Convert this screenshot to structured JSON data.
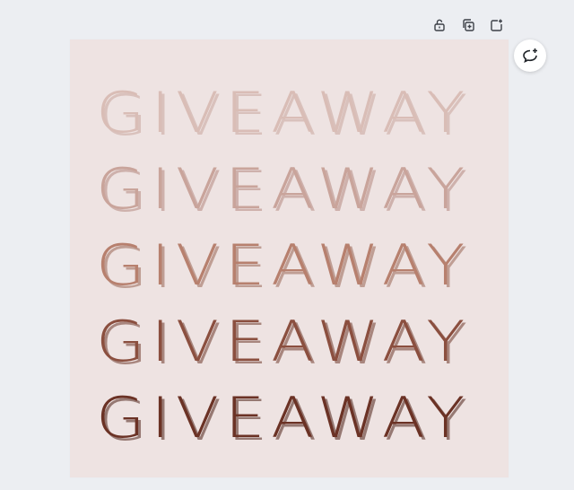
{
  "toolbar": {
    "lock_icon": "lock-open-icon",
    "duplicate_icon": "duplicate-page-icon",
    "add_page_icon": "add-page-icon"
  },
  "comment": {
    "icon": "add-comment-icon"
  },
  "canvas": {
    "background": "#eee3e2",
    "lines": [
      {
        "text": "GIVEAWAY",
        "color": "#d9bdb6",
        "shadow": "#c8a79e"
      },
      {
        "text": "GIVEAWAY",
        "color": "#c9a49b",
        "shadow": "#b48a80"
      },
      {
        "text": "GIVEAWAY",
        "color": "#b7806e",
        "shadow": "#9a6656"
      },
      {
        "text": "GIVEAWAY",
        "color": "#8b4f3f",
        "shadow": "#6f3b2e"
      },
      {
        "text": "GIVEAWAY",
        "color": "#6b3225",
        "shadow": "#4f231a"
      }
    ]
  }
}
